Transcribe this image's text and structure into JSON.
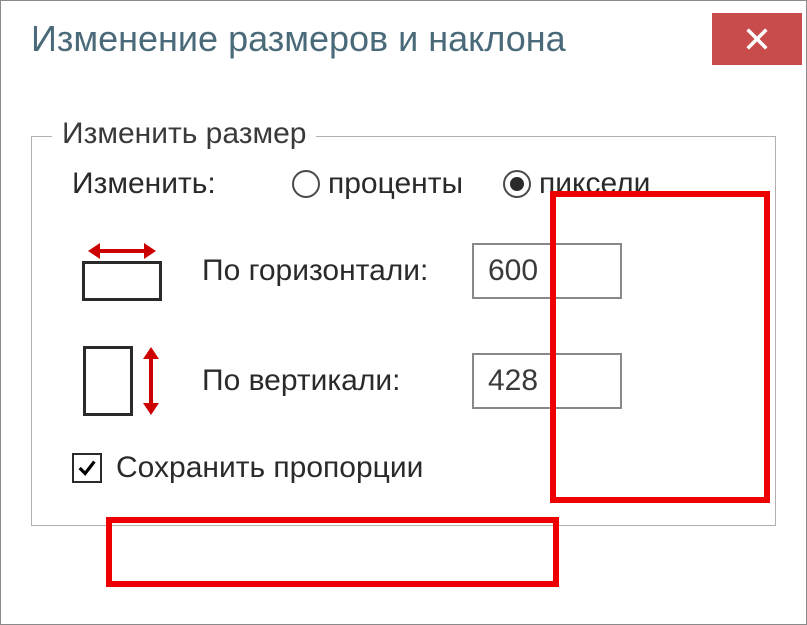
{
  "dialog": {
    "title": "Изменение размеров и наклона"
  },
  "resize": {
    "legend": "Изменить размер",
    "unit_prompt": "Изменить:",
    "percent_label": "проценты",
    "pixels_label": "пиксели",
    "selected_unit": "pixels",
    "horizontal_label": "По горизонтали:",
    "vertical_label": "По вертикали:",
    "horizontal_value": "600",
    "vertical_value": "428",
    "keep_aspect_label": "Сохранить пропорции",
    "keep_aspect_checked": true
  }
}
